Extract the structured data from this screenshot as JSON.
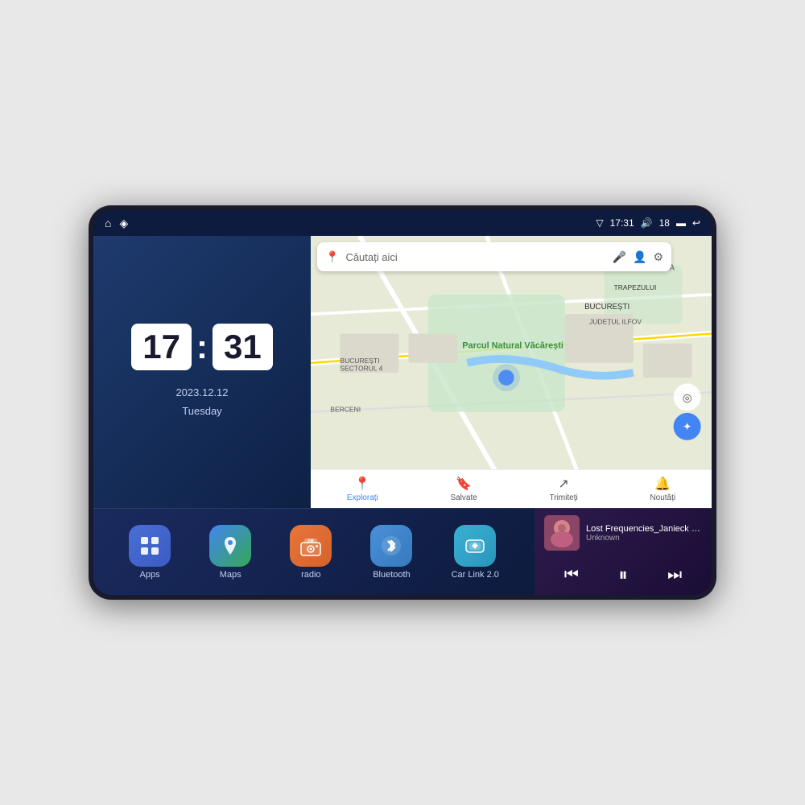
{
  "device": {
    "statusBar": {
      "time": "17:31",
      "signal": "18",
      "leftIcons": [
        "⌂",
        "◈"
      ]
    },
    "clock": {
      "hours": "17",
      "minutes": "31",
      "date": "2023.12.12",
      "day": "Tuesday"
    },
    "map": {
      "searchPlaceholder": "Căutați aici",
      "location": "București",
      "navItems": [
        {
          "label": "Explorați",
          "icon": "📍",
          "active": true
        },
        {
          "label": "Salvate",
          "icon": "🔖",
          "active": false
        },
        {
          "label": "Trimiteți",
          "icon": "🔄",
          "active": false
        },
        {
          "label": "Noutăți",
          "icon": "🔔",
          "active": false
        }
      ]
    },
    "apps": [
      {
        "id": "apps",
        "label": "Apps",
        "icon": "⊞"
      },
      {
        "id": "maps",
        "label": "Maps",
        "icon": "📍"
      },
      {
        "id": "radio",
        "label": "radio",
        "icon": "📻"
      },
      {
        "id": "bluetooth",
        "label": "Bluetooth",
        "icon": "⬡"
      },
      {
        "id": "carlink",
        "label": "Car Link 2.0",
        "icon": "🔗"
      }
    ],
    "musicPlayer": {
      "title": "Lost Frequencies_Janieck Devy-...",
      "artist": "Unknown",
      "controls": {
        "prev": "⏮",
        "play": "⏸",
        "next": "⏭"
      }
    }
  }
}
